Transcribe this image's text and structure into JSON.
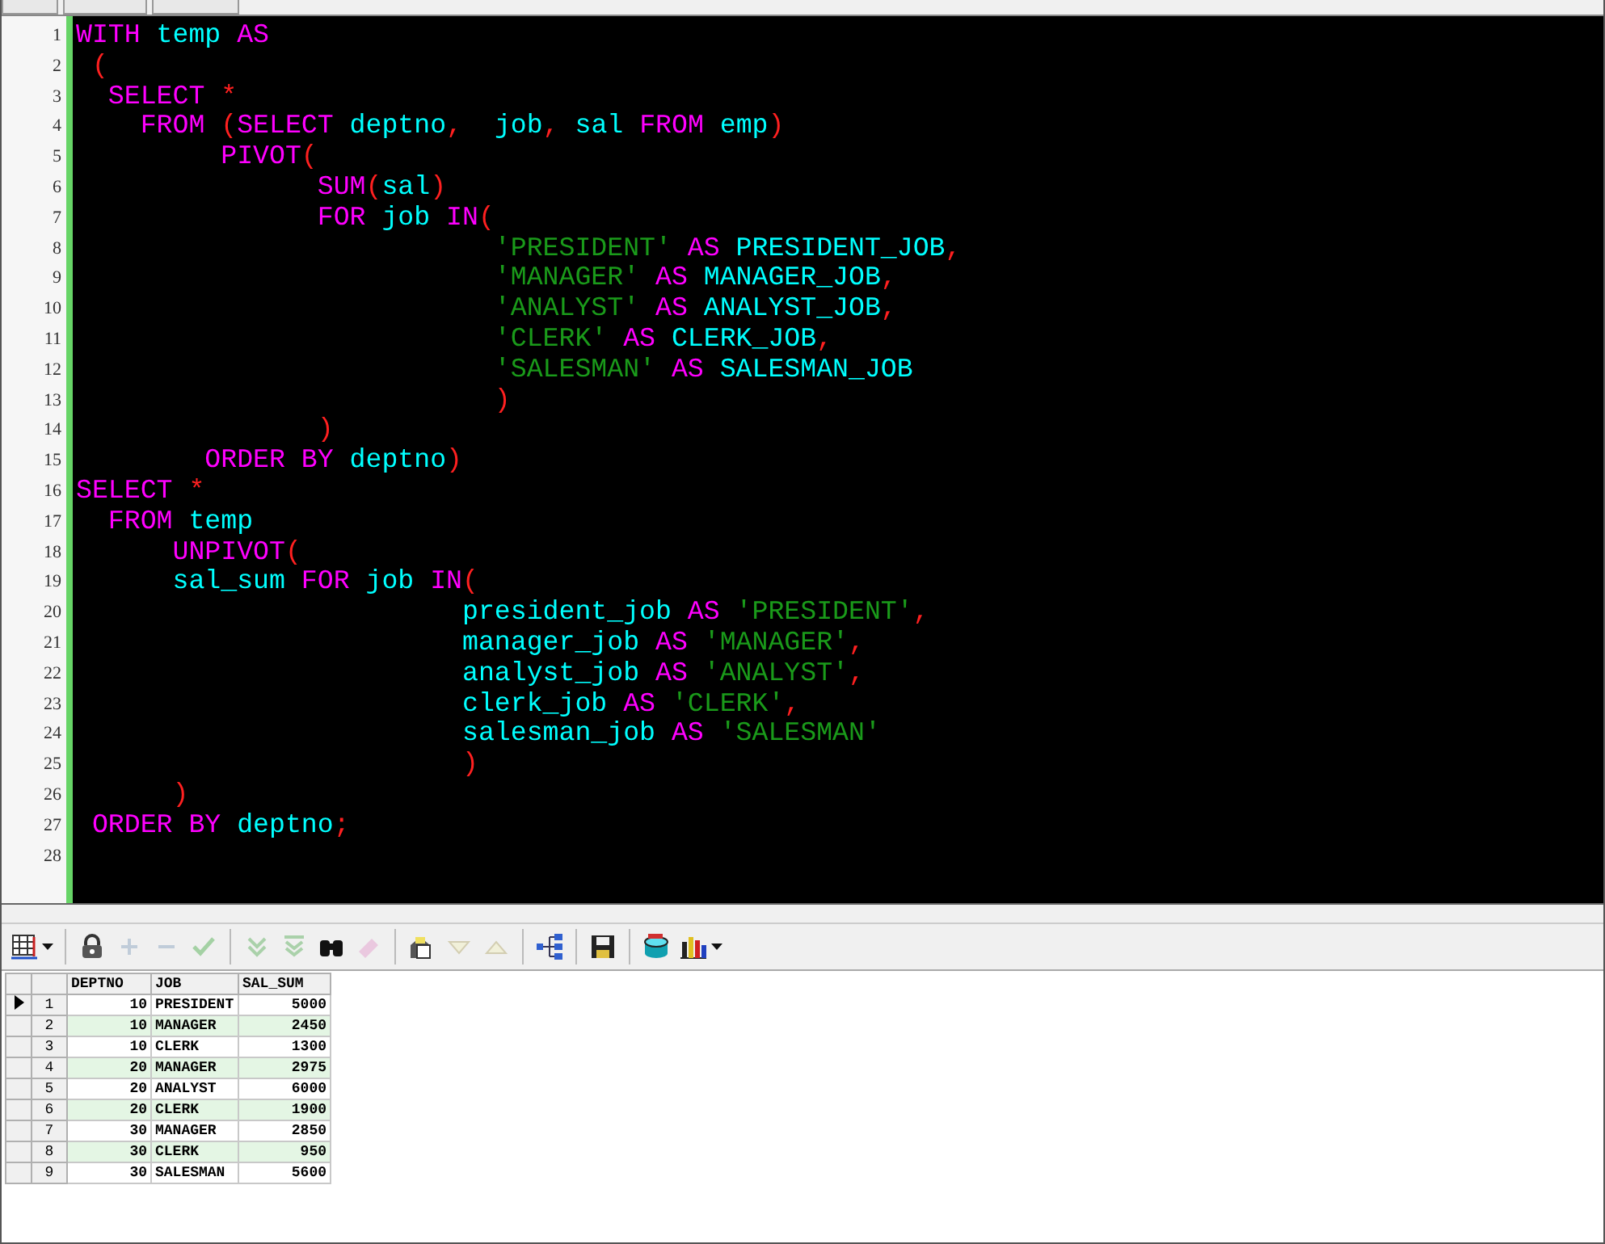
{
  "tabs": [
    {
      "kind": "tab"
    },
    {
      "kind": "tab"
    },
    {
      "kind": "tab"
    }
  ],
  "editor": {
    "lines": [
      {
        "number": "1",
        "tokens": [
          {
            "kind": "kw",
            "text": "WITH"
          },
          {
            "kind": "id",
            "text": " temp"
          },
          {
            "kind": "kw",
            "text": " AS"
          }
        ]
      },
      {
        "number": "2",
        "tokens": [
          {
            "kind": "op",
            "text": " ("
          }
        ]
      },
      {
        "number": "3",
        "tokens": [
          {
            "kind": "kw",
            "text": "  SELECT"
          },
          {
            "kind": "op",
            "text": " *"
          }
        ]
      },
      {
        "number": "4",
        "tokens": [
          {
            "kind": "kw",
            "text": "    FROM"
          },
          {
            "kind": "op",
            "text": " ("
          },
          {
            "kind": "kw",
            "text": "SELECT"
          },
          {
            "kind": "id",
            "text": " deptno"
          },
          {
            "kind": "op",
            "text": ","
          },
          {
            "kind": "id",
            "text": "  job"
          },
          {
            "kind": "op",
            "text": ","
          },
          {
            "kind": "id",
            "text": " sal"
          },
          {
            "kind": "kw",
            "text": " FROM"
          },
          {
            "kind": "id",
            "text": " emp"
          },
          {
            "kind": "op",
            "text": ")"
          }
        ]
      },
      {
        "number": "5",
        "tokens": [
          {
            "kind": "kw",
            "text": "         PIVOT"
          },
          {
            "kind": "op",
            "text": "("
          }
        ]
      },
      {
        "number": "6",
        "tokens": [
          {
            "kind": "kw",
            "text": "               SUM"
          },
          {
            "kind": "op",
            "text": "("
          },
          {
            "kind": "id",
            "text": "sal"
          },
          {
            "kind": "op",
            "text": ")"
          }
        ]
      },
      {
        "number": "7",
        "tokens": [
          {
            "kind": "kw",
            "text": "               FOR"
          },
          {
            "kind": "id",
            "text": " job"
          },
          {
            "kind": "kw",
            "text": " IN"
          },
          {
            "kind": "op",
            "text": "("
          }
        ]
      },
      {
        "number": "8",
        "tokens": [
          {
            "kind": "str",
            "text": "                          'PRESIDENT'"
          },
          {
            "kind": "kw",
            "text": " AS"
          },
          {
            "kind": "id",
            "text": " PRESIDENT_JOB"
          },
          {
            "kind": "op",
            "text": ","
          }
        ]
      },
      {
        "number": "9",
        "tokens": [
          {
            "kind": "str",
            "text": "                          'MANAGER'"
          },
          {
            "kind": "kw",
            "text": " AS"
          },
          {
            "kind": "id",
            "text": " MANAGER_JOB"
          },
          {
            "kind": "op",
            "text": ","
          }
        ]
      },
      {
        "number": "10",
        "tokens": [
          {
            "kind": "str",
            "text": "                          'ANALYST'"
          },
          {
            "kind": "kw",
            "text": " AS"
          },
          {
            "kind": "id",
            "text": " ANALYST_JOB"
          },
          {
            "kind": "op",
            "text": ","
          }
        ]
      },
      {
        "number": "11",
        "tokens": [
          {
            "kind": "str",
            "text": "                          'CLERK'"
          },
          {
            "kind": "kw",
            "text": " AS"
          },
          {
            "kind": "id",
            "text": " CLERK_JOB"
          },
          {
            "kind": "op",
            "text": ","
          }
        ]
      },
      {
        "number": "12",
        "tokens": [
          {
            "kind": "str",
            "text": "                          'SALESMAN'"
          },
          {
            "kind": "kw",
            "text": " AS"
          },
          {
            "kind": "id",
            "text": " SALESMAN_JOB"
          }
        ]
      },
      {
        "number": "13",
        "tokens": [
          {
            "kind": "op",
            "text": "                          )"
          }
        ]
      },
      {
        "number": "14",
        "tokens": [
          {
            "kind": "op",
            "text": "               )"
          }
        ]
      },
      {
        "number": "15",
        "tokens": [
          {
            "kind": "kw",
            "text": "        ORDER BY"
          },
          {
            "kind": "id",
            "text": " deptno"
          },
          {
            "kind": "op",
            "text": ")"
          }
        ]
      },
      {
        "number": "16",
        "tokens": [
          {
            "kind": "kw",
            "text": "SELECT"
          },
          {
            "kind": "op",
            "text": " *"
          }
        ]
      },
      {
        "number": "17",
        "tokens": [
          {
            "kind": "kw",
            "text": "  FROM"
          },
          {
            "kind": "id",
            "text": " temp"
          }
        ]
      },
      {
        "number": "18",
        "tokens": [
          {
            "kind": "kw",
            "text": "      UNPIVOT"
          },
          {
            "kind": "op",
            "text": "("
          }
        ]
      },
      {
        "number": "19",
        "tokens": [
          {
            "kind": "id",
            "text": "      sal_sum"
          },
          {
            "kind": "kw",
            "text": " FOR"
          },
          {
            "kind": "id",
            "text": " job"
          },
          {
            "kind": "kw",
            "text": " IN"
          },
          {
            "kind": "op",
            "text": "("
          }
        ]
      },
      {
        "number": "20",
        "tokens": [
          {
            "kind": "id",
            "text": "                        president_job"
          },
          {
            "kind": "kw",
            "text": " AS"
          },
          {
            "kind": "str",
            "text": " 'PRESIDENT'"
          },
          {
            "kind": "op",
            "text": ","
          }
        ]
      },
      {
        "number": "21",
        "tokens": [
          {
            "kind": "id",
            "text": "                        manager_job"
          },
          {
            "kind": "kw",
            "text": " AS"
          },
          {
            "kind": "str",
            "text": " 'MANAGER'"
          },
          {
            "kind": "op",
            "text": ","
          }
        ]
      },
      {
        "number": "22",
        "tokens": [
          {
            "kind": "id",
            "text": "                        analyst_job"
          },
          {
            "kind": "kw",
            "text": " AS"
          },
          {
            "kind": "str",
            "text": " 'ANALYST'"
          },
          {
            "kind": "op",
            "text": ","
          }
        ]
      },
      {
        "number": "23",
        "tokens": [
          {
            "kind": "id",
            "text": "                        clerk_job"
          },
          {
            "kind": "kw",
            "text": " AS"
          },
          {
            "kind": "str",
            "text": " 'CLERK'"
          },
          {
            "kind": "op",
            "text": ","
          }
        ]
      },
      {
        "number": "24",
        "tokens": [
          {
            "kind": "id",
            "text": "                        salesman_job"
          },
          {
            "kind": "kw",
            "text": " AS"
          },
          {
            "kind": "str",
            "text": " 'SALESMAN'"
          }
        ]
      },
      {
        "number": "25",
        "tokens": [
          {
            "kind": "op",
            "text": "                        )"
          }
        ]
      },
      {
        "number": "26",
        "tokens": [
          {
            "kind": "op",
            "text": "      )"
          }
        ]
      },
      {
        "number": "27",
        "tokens": [
          {
            "kind": "kw",
            "text": " ORDER BY"
          },
          {
            "kind": "id",
            "text": " deptno"
          },
          {
            "kind": "op",
            "text": ";"
          }
        ]
      },
      {
        "number": "28"
      }
    ]
  },
  "toolbar": [
    [
      {
        "kind": "grid",
        "disabled": false,
        "menu": true
      }
    ],
    [
      {
        "kind": "lock",
        "disabled": false,
        "menu": false
      },
      {
        "kind": "plus",
        "disabled": true,
        "menu": false
      },
      {
        "kind": "minus",
        "disabled": true,
        "menu": false
      },
      {
        "kind": "check",
        "disabled": true,
        "menu": false
      }
    ],
    [
      {
        "kind": "chevrons",
        "disabled": true,
        "menu": false
      },
      {
        "kind": "chevrons-bar",
        "disabled": true,
        "menu": false
      },
      {
        "kind": "binoculars",
        "disabled": false,
        "menu": false
      },
      {
        "kind": "eraser",
        "disabled": true,
        "menu": false
      }
    ],
    [
      {
        "kind": "clipboard",
        "disabled": false,
        "menu": false
      },
      {
        "kind": "down",
        "disabled": true,
        "menu": false
      },
      {
        "kind": "up",
        "disabled": true,
        "menu": false
      }
    ],
    [
      {
        "kind": "tree",
        "disabled": false,
        "menu": false
      }
    ],
    [
      {
        "kind": "save",
        "disabled": false,
        "menu": false
      }
    ],
    [
      {
        "kind": "database",
        "disabled": false,
        "menu": false
      },
      {
        "kind": "chart",
        "disabled": false,
        "menu": true
      }
    ]
  ],
  "grid": {
    "columns": [
      "DEPTNO",
      "JOB",
      "SAL_SUM"
    ],
    "rows": [
      {
        "number": "1",
        "selected": true,
        "cells": [
          "10",
          "PRESIDENT",
          "5000"
        ]
      },
      {
        "number": "2",
        "selected": false,
        "cells": [
          "10",
          "MANAGER",
          "2450"
        ]
      },
      {
        "number": "3",
        "selected": false,
        "cells": [
          "10",
          "CLERK",
          "1300"
        ]
      },
      {
        "number": "4",
        "selected": false,
        "cells": [
          "20",
          "MANAGER",
          "2975"
        ]
      },
      {
        "number": "5",
        "selected": false,
        "cells": [
          "20",
          "ANALYST",
          "6000"
        ]
      },
      {
        "number": "6",
        "selected": false,
        "cells": [
          "20",
          "CLERK",
          "1900"
        ]
      },
      {
        "number": "7",
        "selected": false,
        "cells": [
          "30",
          "MANAGER",
          "2850"
        ]
      },
      {
        "number": "8",
        "selected": false,
        "cells": [
          "30",
          "CLERK",
          "950"
        ]
      },
      {
        "number": "9",
        "selected": false,
        "cells": [
          "30",
          "SALESMAN",
          "5600"
        ]
      }
    ]
  }
}
